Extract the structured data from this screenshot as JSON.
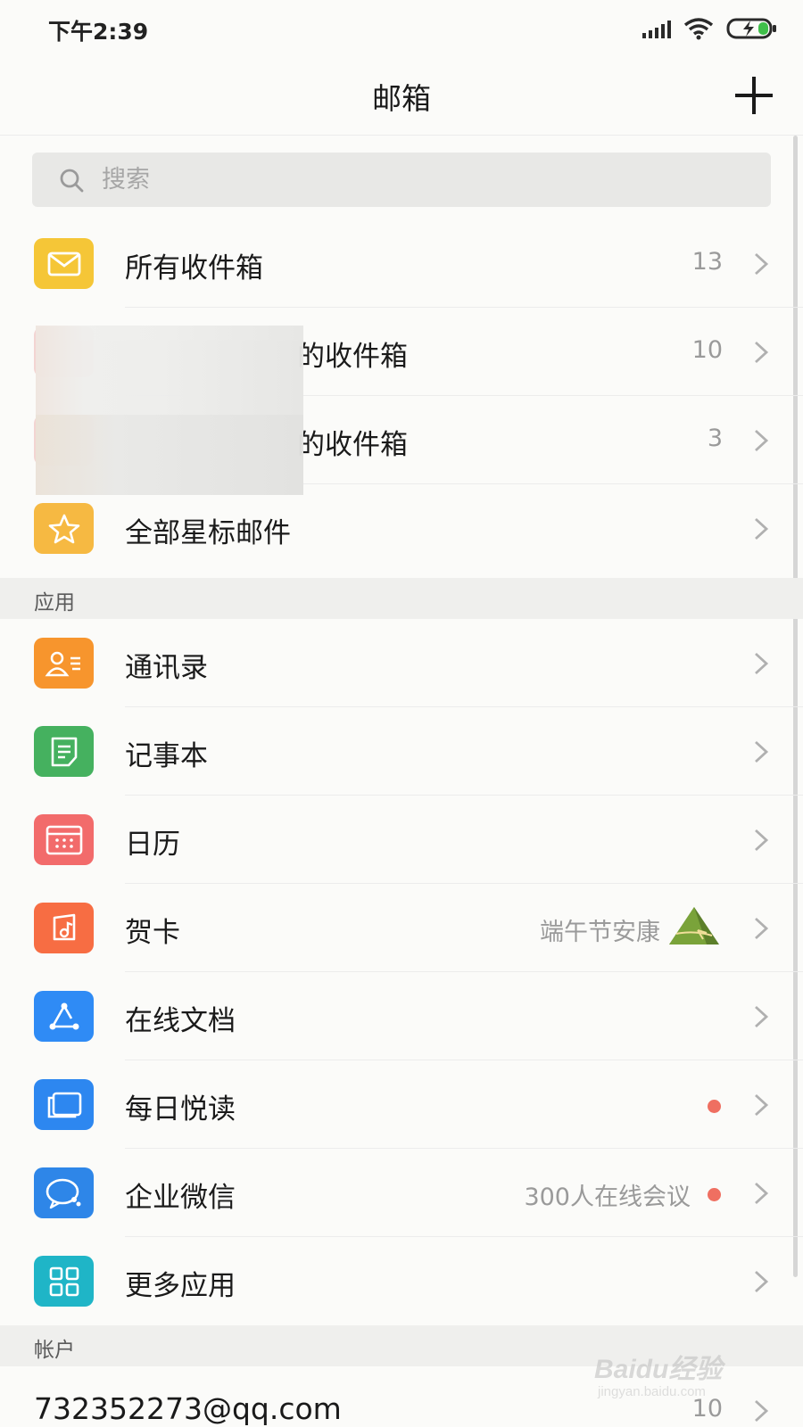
{
  "status_bar": {
    "time": "下午2:39"
  },
  "nav": {
    "title": "邮箱"
  },
  "search": {
    "placeholder": "搜索"
  },
  "mailboxes": [
    {
      "label": "所有收件箱",
      "count": "13",
      "icon": "envelope-icon",
      "color": "#f5c637"
    },
    {
      "label": "的收件箱",
      "count": "10",
      "icon": "account-avatar-icon",
      "color": "#f3d4d2"
    },
    {
      "label": "的收件箱",
      "count": "3",
      "icon": "account-avatar-icon",
      "color": "#f3d4d2"
    },
    {
      "label": "全部星标邮件",
      "count": "",
      "icon": "star-icon",
      "color": "#f6b942"
    }
  ],
  "apps_section": {
    "title": "应用"
  },
  "apps": [
    {
      "label": "通讯录",
      "meta": "",
      "icon": "contacts-icon",
      "color": "#f7952d"
    },
    {
      "label": "记事本",
      "meta": "",
      "icon": "notepad-icon",
      "color": "#45b15f"
    },
    {
      "label": "日历",
      "meta": "",
      "icon": "calendar-icon",
      "color": "#f26b6b"
    },
    {
      "label": "贺卡",
      "meta": "端午节安康",
      "icon": "greeting-card-icon",
      "color": "#f76d43"
    },
    {
      "label": "在线文档",
      "meta": "",
      "icon": "online-doc-icon",
      "color": "#2f8bf5"
    },
    {
      "label": "每日悦读",
      "meta": "",
      "icon": "daily-reading-icon",
      "color": "#2d87f0",
      "dot": true
    },
    {
      "label": "企业微信",
      "meta": "300人在线会议",
      "icon": "wework-icon",
      "color": "#2e86e8",
      "dot": true
    },
    {
      "label": "更多应用",
      "meta": "",
      "icon": "more-apps-icon",
      "color": "#1fb5c7"
    }
  ],
  "account_section": {
    "title": "帐户"
  },
  "account": {
    "email": "732352273@qq.com",
    "count": "10"
  },
  "watermark": {
    "brand": "Baidu经验",
    "url": "jingyan.baidu.com"
  }
}
